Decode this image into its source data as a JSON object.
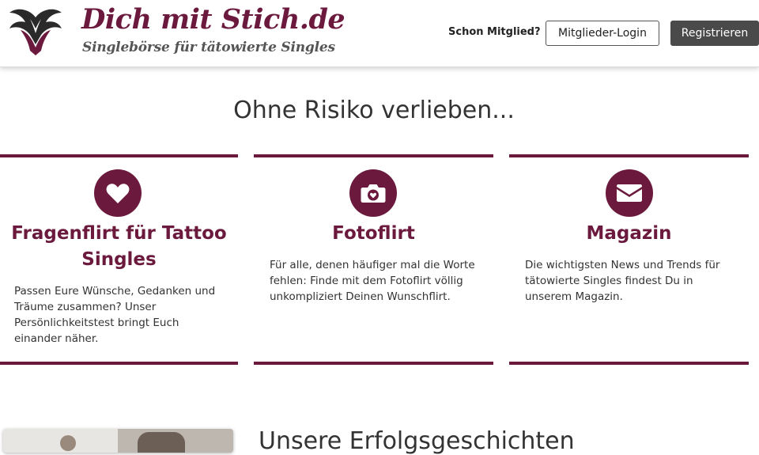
{
  "header": {
    "logo": {
      "title": "Dich mit Stich.de",
      "tagline": "Singlebörse für tätowierte Singles",
      "icon": "tribal-tattoo-logo"
    },
    "member_question": "Schon Mitglied?",
    "login_label": "Mitglieder-Login",
    "register_label": "Registrieren"
  },
  "main": {
    "title": "Ohne Risiko verlieben...",
    "features": [
      {
        "icon": "heart-icon",
        "title_line1": "Fragenflirt für Tattoo",
        "title_line2": "Singles",
        "lines": [
          "Passen Eure Wünsche, Gedanken und",
          "Träume zusammen? Unser",
          "Persönlichkeitstest bringt Euch",
          "einander näher."
        ]
      },
      {
        "icon": "camera-icon",
        "title_line1": "Fotoflirt",
        "lines": [
          "Für alle, denen häufiger mal die Worte",
          "fehlen: Finde mit dem Fotoflirt völlig",
          "unkompliziert Deinen Wunschflirt."
        ]
      },
      {
        "icon": "envelope-icon",
        "title_line1": "Magazin",
        "lines": [
          "Die wichtigsten News und Trends für",
          "tätowierte Singles findest Du in",
          "unserem Magazin."
        ]
      }
    ]
  },
  "success_stories": {
    "title": "Unsere Erfolgsgeschichten"
  },
  "colors": {
    "brand": "#6b1a3e",
    "button_dark": "#4a4a4a",
    "text": "#333333"
  }
}
